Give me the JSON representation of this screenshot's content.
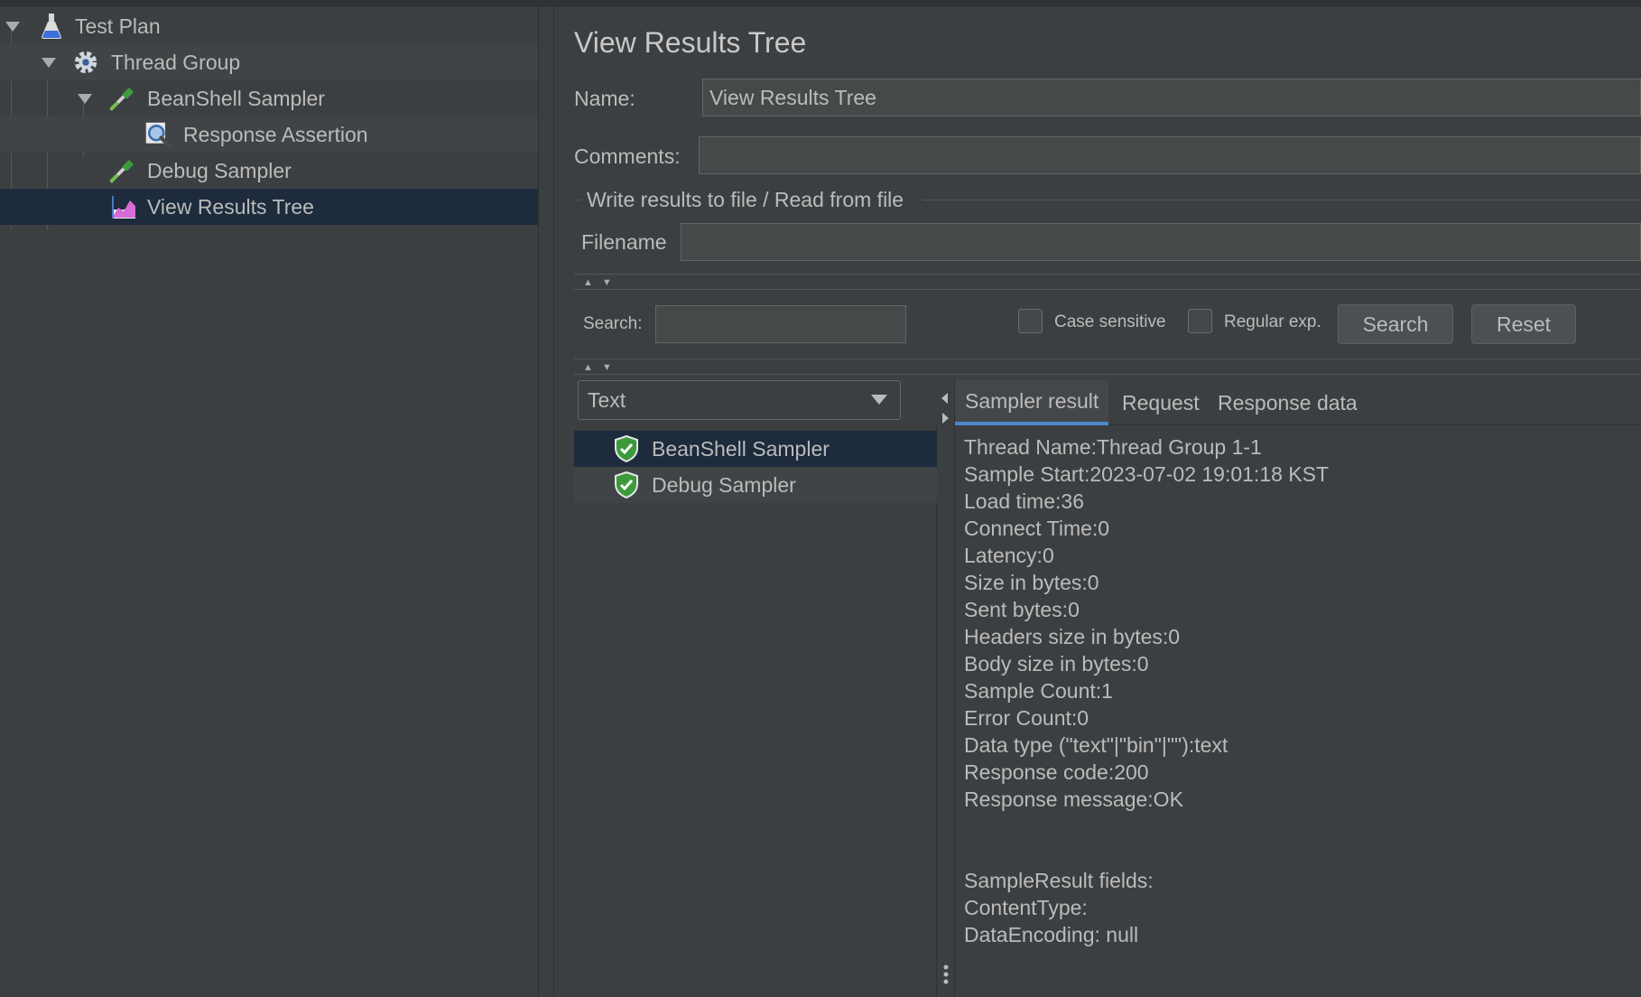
{
  "tree": {
    "items": [
      {
        "label": "Test Plan"
      },
      {
        "label": "Thread Group"
      },
      {
        "label": "BeanShell Sampler"
      },
      {
        "label": "Response Assertion"
      },
      {
        "label": "Debug Sampler"
      },
      {
        "label": "View Results Tree"
      }
    ]
  },
  "panel": {
    "title": "View Results Tree",
    "name_label": "Name:",
    "name_value": "View Results Tree",
    "comments_label": "Comments:",
    "comments_value": "",
    "file_group_label": "Write results to file / Read from file",
    "filename_label": "Filename",
    "filename_value": ""
  },
  "search": {
    "label": "Search:",
    "value": "",
    "case_sensitive_label": "Case sensitive",
    "regex_label": "Regular exp.",
    "search_button": "Search",
    "reset_button": "Reset"
  },
  "renderer": {
    "selected": "Text"
  },
  "results": [
    {
      "label": "BeanShell Sampler",
      "status": "success"
    },
    {
      "label": "Debug Sampler",
      "status": "success"
    }
  ],
  "tabs": [
    {
      "label": "Sampler result",
      "active": true
    },
    {
      "label": "Request",
      "active": false
    },
    {
      "label": "Response data",
      "active": false
    }
  ],
  "sampler_result": [
    "Thread Name:Thread Group 1-1",
    "Sample Start:2023-07-02 19:01:18 KST",
    "Load time:36",
    "Connect Time:0",
    "Latency:0",
    "Size in bytes:0",
    "Sent bytes:0",
    "Headers size in bytes:0",
    "Body size in bytes:0",
    "Sample Count:1",
    "Error Count:0",
    "Data type (\"text\"|\"bin\"|\"\"):text",
    "Response code:200",
    "Response message:OK",
    "",
    "",
    "SampleResult fields:",
    "ContentType:",
    "DataEncoding: null"
  ],
  "colors": {
    "background": "#3c3f41",
    "selection": "#1d2b3c",
    "tab_accent": "#4a88c7",
    "success": "#3c9a3c"
  }
}
